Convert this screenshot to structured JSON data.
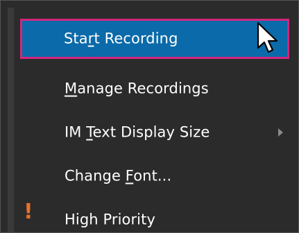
{
  "menu": {
    "items": [
      {
        "pre": "Sta",
        "mnemonic": "r",
        "post": "t Recording",
        "state": "highlighted"
      },
      {
        "pre": "",
        "mnemonic": "M",
        "post": "anage Recordings"
      },
      {
        "pre": "IM ",
        "mnemonic": "T",
        "post": "ext Display Size",
        "has_submenu": true
      },
      {
        "pre": "Change ",
        "mnemonic": "F",
        "post": "ont..."
      },
      {
        "pre": "High Priority",
        "mnemonic": "",
        "post": "",
        "icon": "exclamation-icon",
        "icon_glyph": "!"
      }
    ]
  },
  "colors": {
    "menu_background": "#2b2b2b",
    "highlight": "#0b6aa9",
    "annotation_outline": "#d6267d",
    "priority_icon": "#e8722a",
    "text": "#ffffff"
  },
  "cursor": {
    "icon": "arrow-cursor-icon"
  }
}
